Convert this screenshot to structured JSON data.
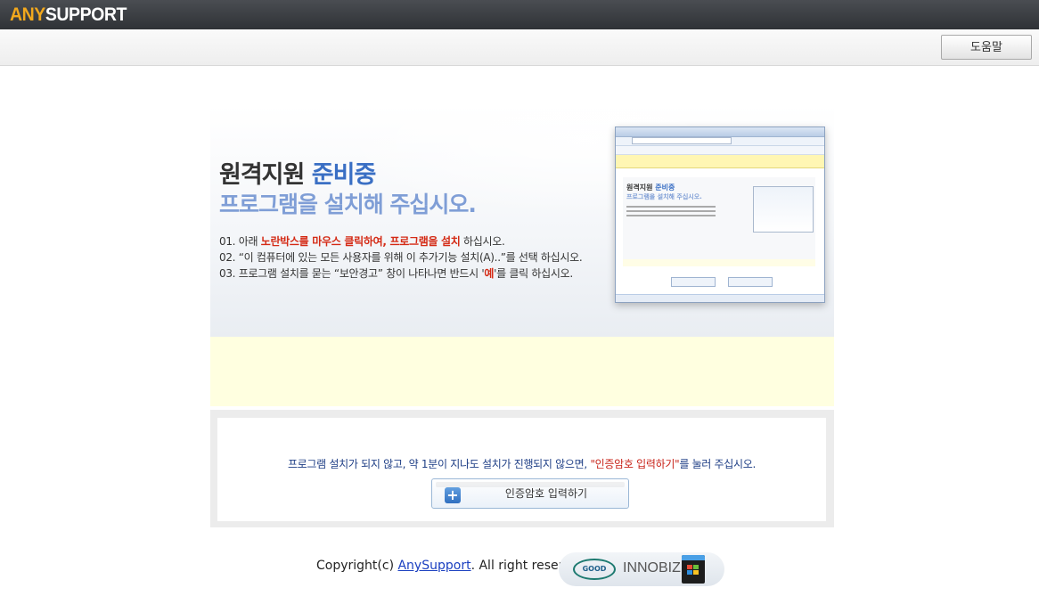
{
  "header": {
    "logo_any": "ANY",
    "logo_support": "SUPPORT",
    "help_label": "도움말"
  },
  "hero": {
    "title_plain": "원격지원 ",
    "title_accent": "준비중",
    "subtitle": "프로그램을 설치해 주십시오.",
    "steps": [
      {
        "prefix": "01. 아래 ",
        "highlight": "노란박스를 마우스 클릭하여, 프로그램을 설치",
        "suffix": " 하십시오."
      },
      {
        "text": "02. “이 컴퓨터에 있는 모든 사용자를 위해 이 추가기능 설치(A)..”를 선택 하십시오."
      },
      {
        "prefix": "03. 프로그램 설치를 묻는 “보안경고” 창이 나타나면 반드시 '",
        "highlight": "예",
        "suffix": "'를 클릭 하십시오."
      }
    ]
  },
  "thumbnail": {
    "title_plain": "원격지원 ",
    "title_accent": "준비중",
    "subtitle": "프로그램을 설치해 주십시오."
  },
  "info": {
    "text_before": "프로그램 설치가 되지 않고, 약 1분이 지나도 설치가 진행되지 않으면, ",
    "text_highlight": "\"인증암호 입력하기\"",
    "text_after": "를 눌러 주십시오.",
    "button_label": "인증암호 입력하기"
  },
  "footer": {
    "copyright_prefix": "Copyright(c) ",
    "link_text": "AnySupport",
    "copyright_suffix": ". All right reserved.",
    "badge_innobiz": "INNOBIZ",
    "badge_good": "GOOD"
  },
  "colors": {
    "accent_blue": "#3a6fc4",
    "subtitle_blue": "#7f9ed6",
    "highlight_red": "#d42a15",
    "logo_orange": "#f2a81d",
    "yellow_box": "#ffffe0"
  }
}
